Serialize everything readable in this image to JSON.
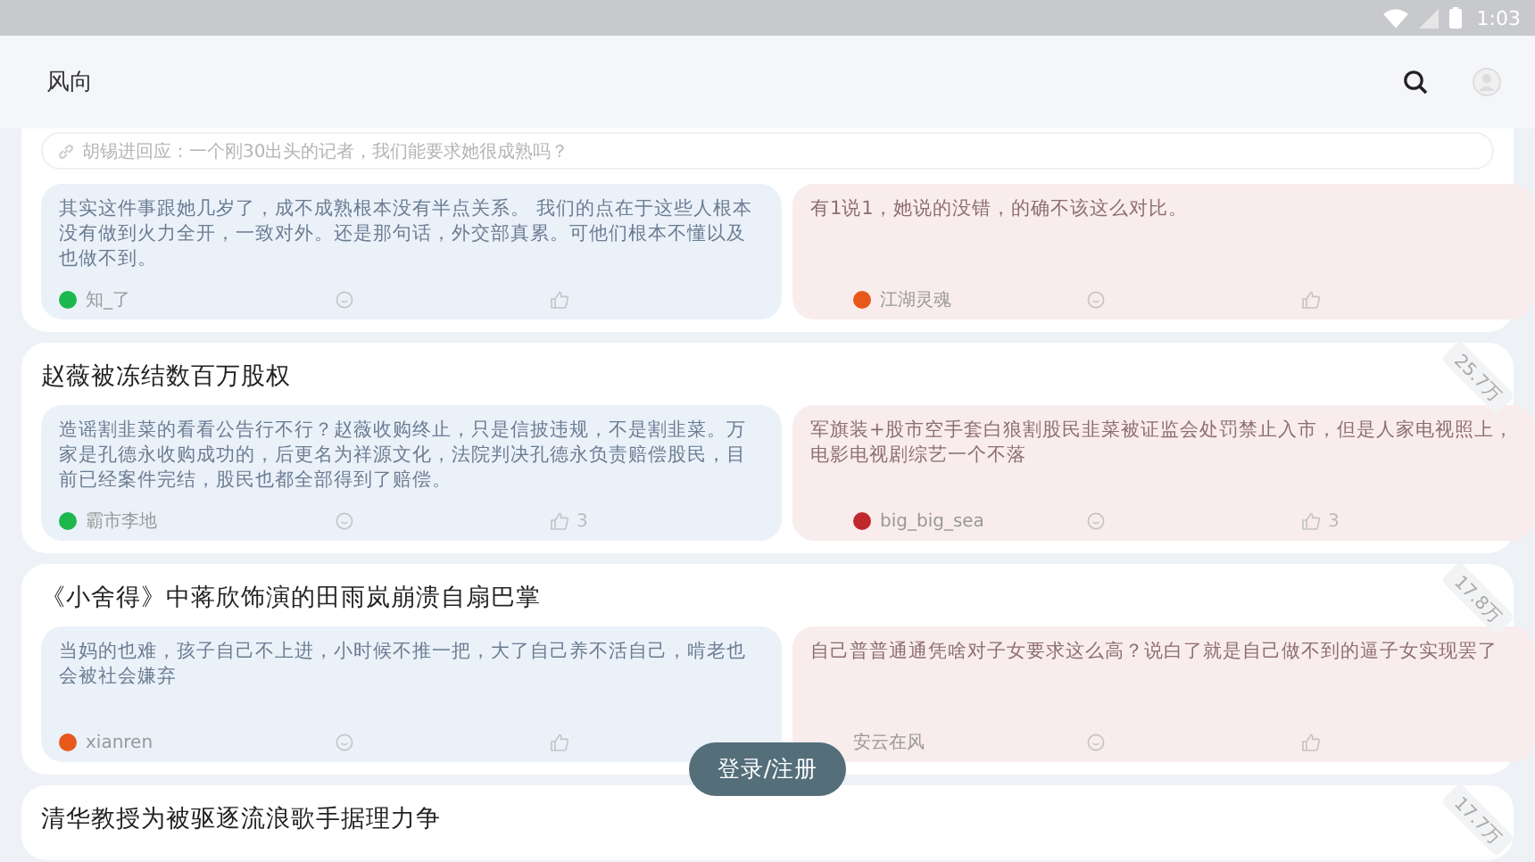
{
  "status_bar": {
    "time": "1:03"
  },
  "app_bar": {
    "title": "风向"
  },
  "topics": [
    {
      "quote": "胡锡进回应：一个刚30出头的记者，我们能要求她很成熟吗？",
      "comments": [
        {
          "text": "其实这件事跟她几岁了，成不成熟根本没有半点关系。 我们的点在于这些人根本没有做到火力全开，一致对外。还是那句话，外交部真累。可他们根本不懂以及也做不到。",
          "author": "知_了",
          "color": "#1db74e"
        },
        {
          "text": "有1说1，她说的没错，的确不该这么对比。",
          "author": "江湖灵魂",
          "color": "#e8581c"
        }
      ]
    },
    {
      "title": "赵薇被冻结数百万股权",
      "heat": "25.7万",
      "comments": [
        {
          "text": "造谣割韭菜的看看公告行不行？赵薇收购终止，只是信披违规，不是割韭菜。万家是孔德永收购成功的，后更名为祥源文化，法院判决孔德永负责赔偿股民，目前已经案件完结，股民也都全部得到了赔偿。",
          "author": "霸市李地",
          "color": "#1db74e",
          "likes": "3"
        },
        {
          "text": "军旗装+股市空手套白狼割股民韭菜被证监会处罚禁止入市，但是人家电视照上，电影电视剧综艺一个不落",
          "author": "big_big_sea",
          "color": "#c0282d",
          "likes": "3"
        }
      ]
    },
    {
      "title": "《小舍得》中蒋欣饰演的田雨岚崩溃自扇巴掌",
      "heat": "17.8万",
      "comments": [
        {
          "text": "当妈的也难，孩子自己不上进，小时候不推一把，大了自己养不活自己，啃老也会被社会嫌弃",
          "author": "xianren",
          "color": "#e8581c"
        },
        {
          "text": "自己普普通通凭啥对子女要求这么高？说白了就是自己做不到的逼子女实现罢了",
          "author": "安云在风"
        }
      ]
    },
    {
      "title": "清华教授为被驱逐流浪歌手据理力争",
      "heat": "17.7万"
    }
  ],
  "login_button": "登录/注册"
}
